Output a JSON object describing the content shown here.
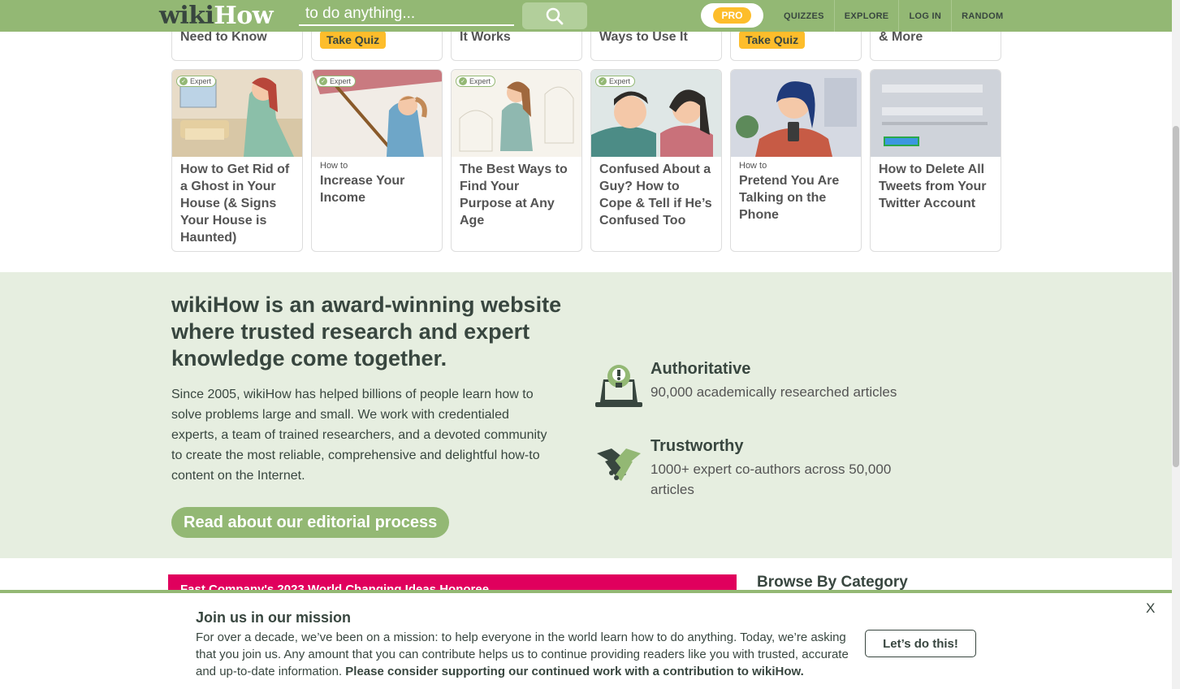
{
  "header": {
    "logo_wiki": "wiki",
    "logo_how": "How",
    "search_placeholder": "to do anything...",
    "pro_label": "PRO",
    "nav": [
      "QUIZZES",
      "EXPLORE",
      "LOG IN",
      "RANDOM"
    ]
  },
  "partial_row": [
    {
      "text": "Need to Know"
    },
    {
      "quiz": "Take Quiz"
    },
    {
      "text": "It Works"
    },
    {
      "text": "Ways to Use It"
    },
    {
      "quiz": "Take Quiz"
    },
    {
      "text": "& More"
    }
  ],
  "cards": [
    {
      "badge": "Expert",
      "howto": "",
      "title": "How to Get Rid of a Ghost in Your House (& Signs Your House is Haunted)"
    },
    {
      "badge": "Expert",
      "howto": "How to",
      "title": "Increase Your Income"
    },
    {
      "badge": "Expert",
      "howto": "",
      "title": "The Best Ways to Find Your Purpose at Any Age"
    },
    {
      "badge": "Expert",
      "howto": "",
      "title": "Confused About a Guy? How to Cope & Tell if He’s Confused Too"
    },
    {
      "badge": "",
      "howto": "How to",
      "title": "Pretend You Are Talking on the Phone"
    },
    {
      "badge": "",
      "howto": "",
      "title": "How to Delete All Tweets from Your Twitter Account"
    }
  ],
  "trust": {
    "heading": "wikiHow is an award-winning website where trusted research and expert knowledge come together.",
    "text": "Since 2005, wikiHow has helped billions of people learn how to solve problems large and small. We work with credentialed experts, a team of trained researchers, and a devoted community to create the most reliable, comprehensive and delightful how-to content on the Internet.",
    "button": "Read about our editorial process",
    "features": [
      {
        "title": "Authoritative",
        "desc": "90,000 academically researched articles"
      },
      {
        "title": "Trustworthy",
        "desc": "1000+ expert co-authors across 50,000 articles"
      }
    ]
  },
  "lower": {
    "banner": "Fast Company's 2023 World Changing Ideas Honoree",
    "browse": "Browse By Category"
  },
  "mission": {
    "title": "Join us in our mission",
    "text": "For over a decade, we’ve been on a mission: to help everyone in the world learn how to do anything. Today, we’re asking that you join us. Any amount that you can contribute helps us to continue providing readers like you with trusted, accurate and up-to-date information. ",
    "text_bold": "Please consider supporting our continued work with a contribution to wikiHow.",
    "button": "Let’s do this!",
    "close": "X"
  },
  "colors": {
    "brand_green": "#93b874",
    "dark_green": "#38463f",
    "light_green_bg": "#e6eee0",
    "quiz_yellow": "#fdbd2b",
    "banner_pink": "#e0005d"
  }
}
